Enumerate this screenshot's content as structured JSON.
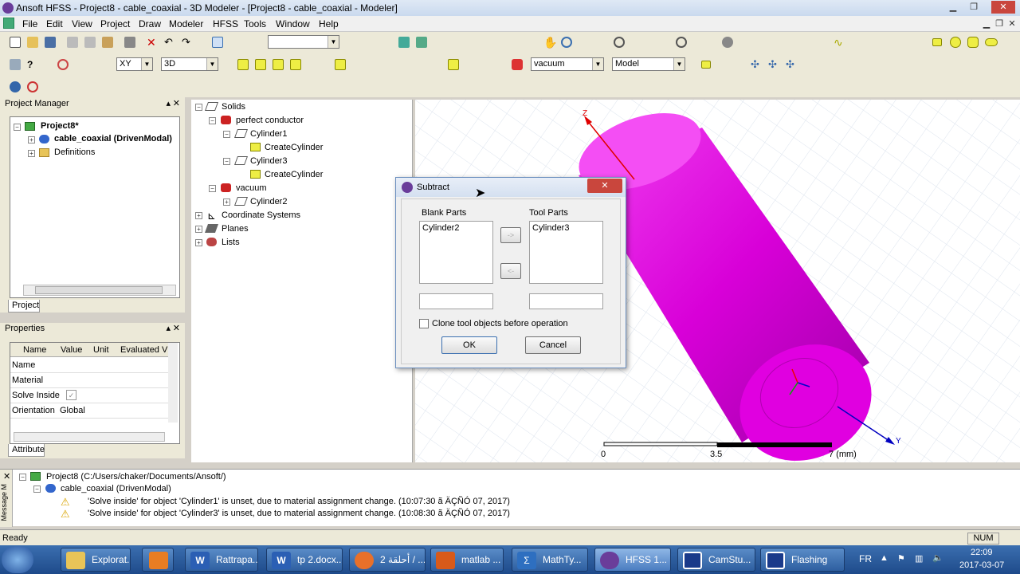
{
  "window": {
    "title": "Ansoft HFSS - Project8 - cable_coaxial - 3D Modeler - [Project8 - cable_coaxial - Modeler]"
  },
  "menu": [
    "File",
    "Edit",
    "View",
    "Project",
    "Draw",
    "Modeler",
    "HFSS",
    "Tools",
    "Window",
    "Help"
  ],
  "toolbar": {
    "plane": "XY",
    "view": "3D",
    "material": "vacuum",
    "model": "Model"
  },
  "project_manager": {
    "title": "Project Manager",
    "project": "Project8*",
    "design": "cable_coaxial (DrivenModal)",
    "definitions": "Definitions",
    "tab": "Project"
  },
  "properties": {
    "title": "Properties",
    "columns": [
      "Name",
      "Value",
      "Unit",
      "Evaluated V"
    ],
    "rows": [
      {
        "name": "Name",
        "value": ""
      },
      {
        "name": "Material",
        "value": ""
      },
      {
        "name": "Solve Inside",
        "value": "✓"
      },
      {
        "name": "Orientation",
        "value": "Global"
      }
    ],
    "tab": "Attribute"
  },
  "model_tree": {
    "solids": "Solids",
    "perfect_conductor": "perfect conductor",
    "cylinder1": "Cylinder1",
    "create_cyl1": "CreateCylinder",
    "cylinder3": "Cylinder3",
    "create_cyl3": "CreateCylinder",
    "vacuum": "vacuum",
    "cylinder2": "Cylinder2",
    "coord": "Coordinate Systems",
    "planes": "Planes",
    "lists": "Lists"
  },
  "viewport": {
    "axis_z": "Z",
    "axis_y": "Y",
    "scale": [
      "0",
      "3.5",
      "7 (mm)"
    ],
    "object_color": "#e000e0"
  },
  "dialog": {
    "title": "Subtract",
    "blank_label": "Blank Parts",
    "tool_label": "Tool Parts",
    "blank_item": "Cylinder2",
    "tool_item": "Cylinder3",
    "arrow_right": "->",
    "arrow_left": "<-",
    "clone_label": "Clone tool objects before operation",
    "ok": "OK",
    "cancel": "Cancel"
  },
  "messages": {
    "project": "Project8 (C:/Users/chaker/Documents/Ansoft/)",
    "design": "cable_coaxial (DrivenModal)",
    "line1": "'Solve inside' for object 'Cylinder1' is unset, due to material assignment change. (10:07:30 ã ÄÇÑÓ 07, 2017)",
    "line2": "'Solve inside' for object 'Cylinder3' is unset, due to material assignment change. (10:08:30 ã ÄÇÑÓ 07, 2017)",
    "side_label": "Message M"
  },
  "status": {
    "text": "Ready",
    "num": "NUM"
  },
  "taskbar": {
    "items": [
      "Explorat...",
      "",
      "Rattrapa...",
      "tp 2.docx...",
      "أحلقة 2 / ...",
      "matlab ...",
      "MathTy...",
      "HFSS 1...",
      "CamStu...",
      "Flashing"
    ],
    "lang": "FR",
    "time": "22:09",
    "date": "2017-03-07"
  }
}
